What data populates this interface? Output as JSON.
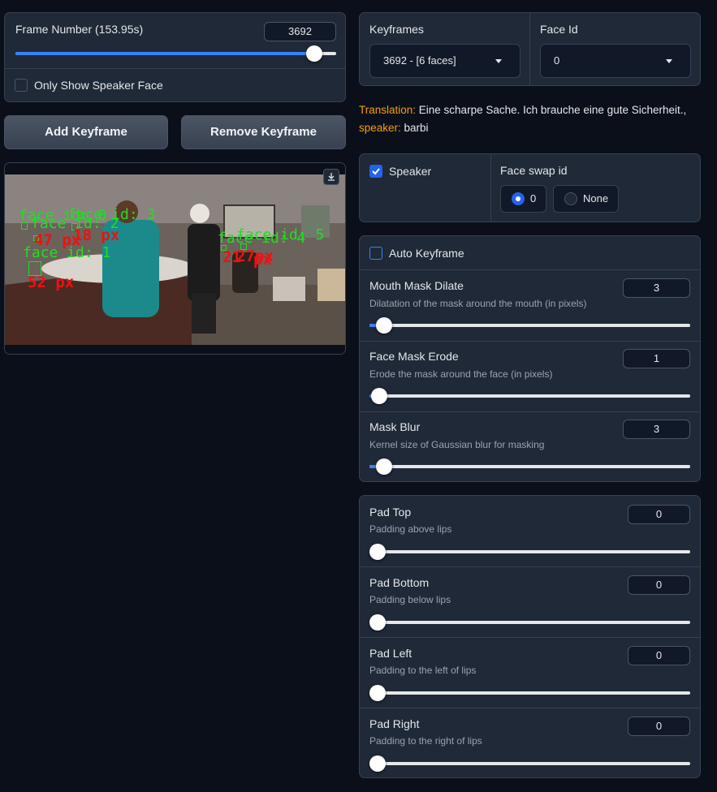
{
  "frame": {
    "label": "Frame Number (153.95s)",
    "value": "3692",
    "fraction": 0.93
  },
  "only_speaker": {
    "label": "Only Show Speaker Face",
    "checked": false
  },
  "buttons": {
    "add": "Add Keyframe",
    "remove": "Remove Keyframe"
  },
  "video": {
    "download_icon": "download-icon",
    "annotations_green": [
      "face id: 0",
      "face id: 2",
      "face id: 3",
      "face id: 1",
      "face id: 4",
      "face id: 5"
    ],
    "annotations_red": [
      "47 px",
      "18 px",
      "52 px",
      "21",
      "27px",
      "px"
    ]
  },
  "keyframes": {
    "label": "Keyframes",
    "value": "3692  - [6 faces]"
  },
  "face_id": {
    "label": "Face Id",
    "value": "0"
  },
  "translation": {
    "key": "Translation:",
    "text": " Eine scharpe Sache. Ich brauche eine gute Sicherheit.,",
    "speaker_key": "speaker:",
    "speaker": " barbi"
  },
  "speaker_box": {
    "label": "Speaker",
    "checked": true
  },
  "face_swap": {
    "label": "Face swap id",
    "options": [
      "0",
      "None"
    ],
    "selected": "0"
  },
  "auto_keyframe": {
    "label": "Auto Keyframe",
    "checked": false
  },
  "sliders_a": [
    {
      "label": "Mouth Mask Dilate",
      "info": "Dilatation of the mask around the mouth (in pixels)",
      "value": "3"
    },
    {
      "label": "Face Mask Erode",
      "info": "Erode the mask around the face (in pixels)",
      "value": "1"
    },
    {
      "label": "Mask Blur",
      "info": "Kernel size of Gaussian blur for masking",
      "value": "3"
    }
  ],
  "sliders_b": [
    {
      "label": "Pad Top",
      "info": "Padding above lips",
      "value": "0"
    },
    {
      "label": "Pad Bottom",
      "info": "Padding below lips",
      "value": "0"
    },
    {
      "label": "Pad Left",
      "info": "Padding to the left of lips",
      "value": "0"
    },
    {
      "label": "Pad Right",
      "info": "Padding to the right of lips",
      "value": "0"
    }
  ],
  "colors": {
    "accent": "#3b82f6",
    "orange": "#f59e0b",
    "bg": "#0b0f19",
    "panel": "#1f2937"
  }
}
